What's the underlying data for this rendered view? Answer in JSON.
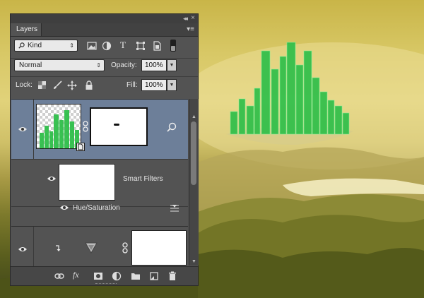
{
  "panel": {
    "tab_label": "Layers",
    "kind_filter": "Kind",
    "blend_mode": "Normal",
    "opacity_label": "Opacity:",
    "opacity_value": "100%",
    "lock_label": "Lock:",
    "fill_label": "Fill:",
    "fill_value": "100%"
  },
  "layers": [
    {
      "id": "city",
      "selected": true,
      "visible": true
    },
    {
      "id": "smart-filters",
      "label": "Smart Filters"
    },
    {
      "id": "hue-sat",
      "label": "Hue/Saturation"
    },
    {
      "id": "adjust",
      "visible": true
    }
  ],
  "colors": {
    "panel_bg": "#535353",
    "selected_row": "#6d7f99",
    "city_green": "#2fbf4a",
    "sky_yellow": "#dccb6f"
  },
  "bottom_icons": [
    "link-icon",
    "fx-icon",
    "mask-icon",
    "adjustment-icon",
    "group-folder-icon",
    "new-layer-icon",
    "trash-icon"
  ]
}
